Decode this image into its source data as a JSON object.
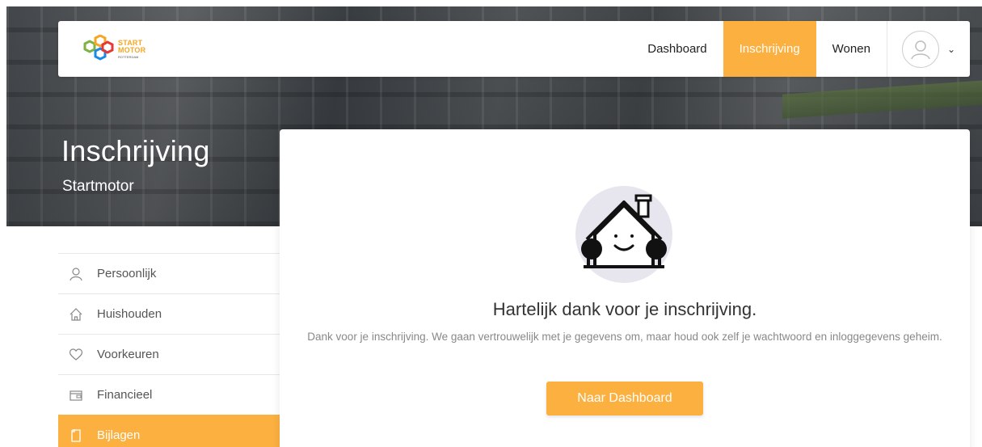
{
  "brand": {
    "line1": "START",
    "line2": "MOTOR",
    "line3": "ROTTERDAM",
    "accent": "#fbb040"
  },
  "nav": {
    "items": [
      {
        "label": "Dashboard",
        "active": false
      },
      {
        "label": "Inschrijving",
        "active": true
      },
      {
        "label": "Wonen",
        "active": false
      }
    ],
    "user_icon": "user-icon",
    "dropdown_icon": "chevron-down-icon"
  },
  "hero": {
    "title": "Inschrijving",
    "subtitle": "Startmotor"
  },
  "sidebar": {
    "items": [
      {
        "label": "Persoonlijk",
        "icon": "user-icon",
        "active": false
      },
      {
        "label": "Huishouden",
        "icon": "home-icon",
        "active": false
      },
      {
        "label": "Voorkeuren",
        "icon": "heart-icon",
        "active": false
      },
      {
        "label": "Financieel",
        "icon": "wallet-icon",
        "active": false
      },
      {
        "label": "Bijlagen",
        "icon": "document-icon",
        "active": true
      }
    ]
  },
  "confirmation": {
    "title": "Hartelijk dank voor je inschrijving.",
    "body": "Dank voor je inschrijving. We gaan vertrouwelijk met je gegevens om, maar houd ook zelf je wachtwoord en inloggegevens geheim.",
    "button_label": "Naar Dashboard",
    "illustration": "happy-house-icon"
  }
}
